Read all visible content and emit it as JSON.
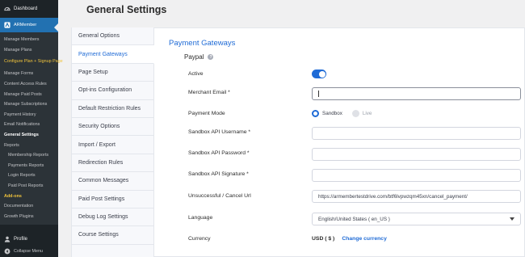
{
  "sidebar": {
    "dashboard": "Dashboard",
    "plugin": "ARMember",
    "items": [
      {
        "label": "Manage Members",
        "style": "plain"
      },
      {
        "label": "Manage Plans",
        "style": "plain"
      },
      {
        "label": "Configure Plan + Signup Page",
        "style": "yellow"
      },
      {
        "label": "Manage Forms",
        "style": "plain"
      },
      {
        "label": "Content Access Rules",
        "style": "plain"
      },
      {
        "label": "Manage Paid Posts",
        "style": "plain"
      },
      {
        "label": "Manage Subscriptions",
        "style": "plain"
      },
      {
        "label": "Payment History",
        "style": "plain"
      },
      {
        "label": "Email Notifications",
        "style": "plain"
      },
      {
        "label": "General Settings",
        "style": "current"
      },
      {
        "label": "Reports",
        "style": "plain"
      },
      {
        "label": "Membership Reports",
        "style": "indent"
      },
      {
        "label": "Payments Reports",
        "style": "indent"
      },
      {
        "label": "Login Reports",
        "style": "indent"
      },
      {
        "label": "Paid Post Reports",
        "style": "indent"
      },
      {
        "label": "Add-ons",
        "style": "green"
      },
      {
        "label": "Documentation",
        "style": "plain"
      },
      {
        "label": "Growth Plugins",
        "style": "plain"
      }
    ],
    "profile": "Profile",
    "collapse": "Collapse Menu"
  },
  "page": {
    "title": "General Settings"
  },
  "tabs": [
    {
      "label": "General Options",
      "active": false
    },
    {
      "label": "Payment Gateways",
      "active": true
    },
    {
      "label": "Page Setup",
      "active": false
    },
    {
      "label": "Opt-ins Configuration",
      "active": false
    },
    {
      "label": "Default Restriction Rules",
      "active": false
    },
    {
      "label": "Security Options",
      "active": false
    },
    {
      "label": "Import / Export",
      "active": false
    },
    {
      "label": "Redirection Rules",
      "active": false
    },
    {
      "label": "Common Messages",
      "active": false
    },
    {
      "label": "Paid Post Settings",
      "active": false
    },
    {
      "label": "Debug Log Settings",
      "active": false
    },
    {
      "label": "Course Settings",
      "active": false
    }
  ],
  "content": {
    "section_title": "Payment Gateways",
    "gateway_name": "Paypal",
    "help_glyph": "?",
    "active_label": "Active",
    "active_on": true,
    "merchant_email_label": "Merchant Email *",
    "merchant_email_value": "",
    "payment_mode_label": "Payment Mode",
    "mode_sandbox": "Sandbox",
    "mode_live": "Live",
    "mode_selected": "Sandbox",
    "api_username_label": "Sandbox API Username *",
    "api_username_value": "",
    "api_password_label": "Sandbox API Password *",
    "api_password_value": "",
    "api_signature_label": "Sandbox API Signature *",
    "api_signature_value": "",
    "cancel_url_label": "Unsuccessful / Cancel Url",
    "cancel_url_value": "https://armembertestdrive.com/btf6lvpwzqm45xn/cancel_payment/",
    "language_label": "Language",
    "language_value": "English/United States ( en_US )",
    "currency_label": "Currency",
    "currency_value": "USD ( $ )",
    "change_currency": "Change currency"
  },
  "colors": {
    "accent": "#1f6bd6",
    "sidebar_bg": "#1d2327",
    "sidebar_active": "#2271b1"
  }
}
